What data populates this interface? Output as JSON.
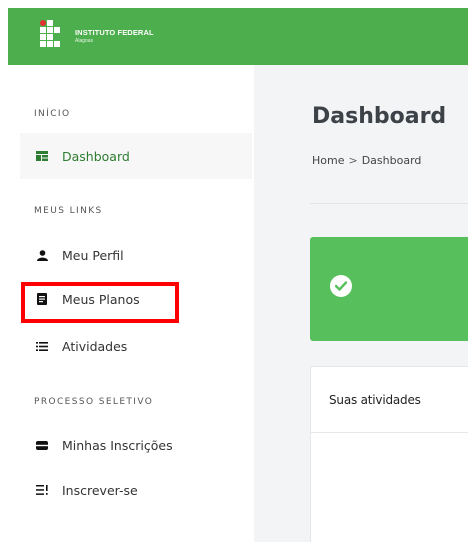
{
  "header": {
    "logo_title": "INSTITUTO FEDERAL",
    "logo_subtitle": "Alagoas",
    "background_color": "#4cae4c"
  },
  "sidebar": {
    "sections": [
      {
        "label": "INÍCIO",
        "items": [
          {
            "label": "Dashboard",
            "icon": "dashboard-icon",
            "active": true
          }
        ]
      },
      {
        "label": "MEUS LINKS",
        "items": [
          {
            "label": "Meu Perfil",
            "icon": "user-icon"
          },
          {
            "label": "Meus Planos",
            "icon": "document-icon",
            "highlighted": true
          },
          {
            "label": "Atividades",
            "icon": "list-icon"
          }
        ]
      },
      {
        "label": "PROCESSO SELETIVO",
        "items": [
          {
            "label": "Minhas Inscrições",
            "icon": "id-card-icon"
          },
          {
            "label": "Inscrever-se",
            "icon": "checklist-icon"
          }
        ]
      }
    ]
  },
  "main": {
    "title": "Dashboard",
    "breadcrumb": {
      "home": "Home",
      "separator": ">",
      "current": "Dashboard"
    },
    "alert": {
      "icon": "check-circle-icon",
      "color": "#57c05d"
    },
    "card": {
      "title": "Suas atividades"
    }
  },
  "annotation": {
    "highlight_color": "#ff0000",
    "target": "Meus Planos"
  }
}
